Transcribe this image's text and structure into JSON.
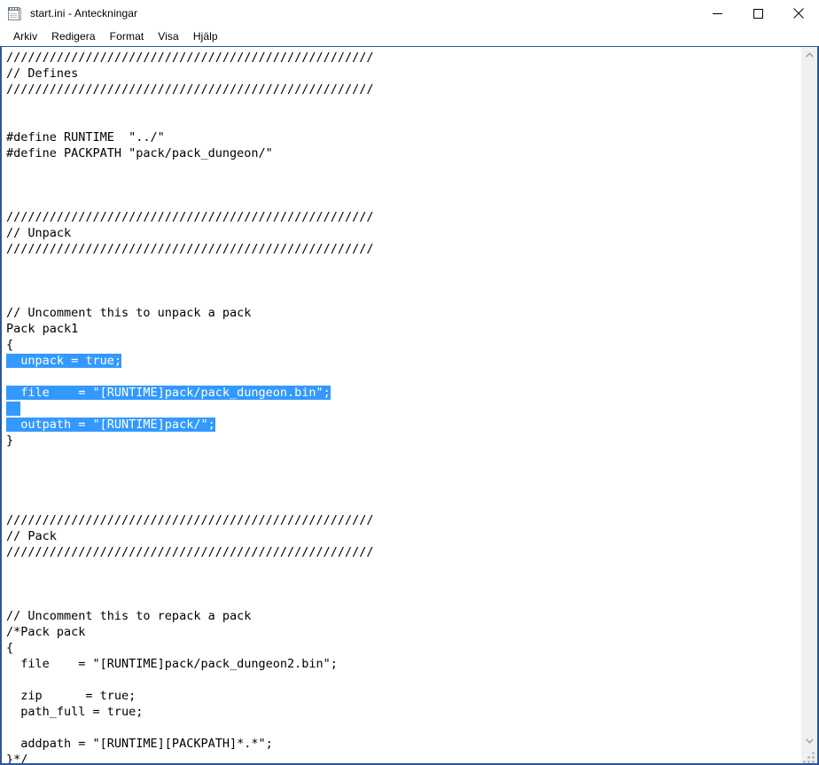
{
  "window": {
    "title": "start.ini - Anteckningar",
    "icon": "notepad-icon",
    "border_color": "#2b5797",
    "controls": {
      "minimize": "Minimera",
      "maximize": "Maximera",
      "close": "Stäng"
    }
  },
  "menubar": {
    "items": [
      {
        "label": "Arkiv"
      },
      {
        "label": "Redigera"
      },
      {
        "label": "Format"
      },
      {
        "label": "Visa"
      },
      {
        "label": "Hjälp"
      }
    ]
  },
  "editor": {
    "selection_color": "#3399ff",
    "selection_text_color": "#ffffff",
    "text_color": "#000000",
    "background_color": "#ffffff",
    "lines": [
      {
        "text": "///////////////////////////////////////////////////",
        "selected": false
      },
      {
        "text": "// Defines",
        "selected": false
      },
      {
        "text": "///////////////////////////////////////////////////",
        "selected": false
      },
      {
        "text": "",
        "selected": false
      },
      {
        "text": "",
        "selected": false
      },
      {
        "text": "#define RUNTIME  \"../\"",
        "selected": false
      },
      {
        "text": "#define PACKPATH \"pack/pack_dungeon/\"",
        "selected": false
      },
      {
        "text": "",
        "selected": false
      },
      {
        "text": "",
        "selected": false
      },
      {
        "text": "",
        "selected": false
      },
      {
        "text": "///////////////////////////////////////////////////",
        "selected": false
      },
      {
        "text": "// Unpack",
        "selected": false
      },
      {
        "text": "///////////////////////////////////////////////////",
        "selected": false
      },
      {
        "text": "",
        "selected": false
      },
      {
        "text": "",
        "selected": false
      },
      {
        "text": "",
        "selected": false
      },
      {
        "text": "// Uncomment this to unpack a pack",
        "selected": false
      },
      {
        "text": "Pack pack1",
        "selected": false
      },
      {
        "text": "{",
        "selected": false
      },
      {
        "text": "  unpack = true;",
        "selected": true
      },
      {
        "text": "",
        "selected": false
      },
      {
        "text": "  file    = \"[RUNTIME]pack/pack_dungeon.bin\";",
        "selected": true
      },
      {
        "text": "  ",
        "selected": true
      },
      {
        "text": "  outpath = \"[RUNTIME]pack/\";",
        "selected": true
      },
      {
        "text": "}",
        "selected": false
      },
      {
        "text": "",
        "selected": false
      },
      {
        "text": "",
        "selected": false
      },
      {
        "text": "",
        "selected": false
      },
      {
        "text": "",
        "selected": false
      },
      {
        "text": "///////////////////////////////////////////////////",
        "selected": false
      },
      {
        "text": "// Pack",
        "selected": false
      },
      {
        "text": "///////////////////////////////////////////////////",
        "selected": false
      },
      {
        "text": "",
        "selected": false
      },
      {
        "text": "",
        "selected": false
      },
      {
        "text": "",
        "selected": false
      },
      {
        "text": "// Uncomment this to repack a pack",
        "selected": false
      },
      {
        "text": "/*Pack pack",
        "selected": false
      },
      {
        "text": "{",
        "selected": false
      },
      {
        "text": "  file    = \"[RUNTIME]pack/pack_dungeon2.bin\";",
        "selected": false
      },
      {
        "text": "",
        "selected": false
      },
      {
        "text": "  zip      = true;",
        "selected": false
      },
      {
        "text": "  path_full = true;",
        "selected": false
      },
      {
        "text": "",
        "selected": false
      },
      {
        "text": "  addpath = \"[RUNTIME][PACKPATH]*.*\";",
        "selected": false
      },
      {
        "text": "}*/",
        "selected": false
      }
    ]
  },
  "scrollbar": {
    "up_arrow": "chevron-up-icon",
    "down_arrow": "chevron-down-icon",
    "resize_grip": "resize-grip-icon"
  }
}
